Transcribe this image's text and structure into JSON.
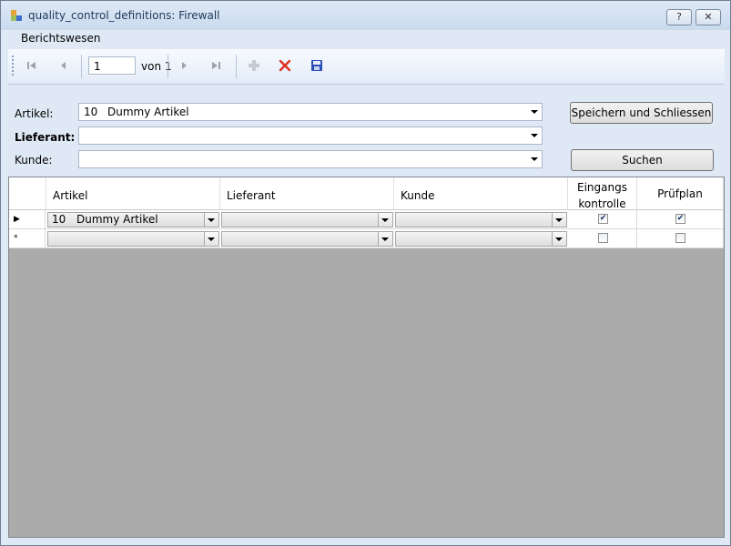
{
  "window": {
    "title": "quality_control_definitions: Firewall",
    "help_btn": "?",
    "close_btn": "✕"
  },
  "menu": {
    "items": [
      "Berichtswesen"
    ]
  },
  "navigator": {
    "position": "1",
    "count_text": "von 1",
    "colors": {
      "delete": "#e0301e",
      "save": "#2b4fb8"
    }
  },
  "form": {
    "artikel_label": "Artikel:",
    "artikel_num": "10",
    "artikel_name": "Dummy Artikel",
    "lieferant_label": "Lieferant:",
    "lieferant_value": "",
    "kunde_label": "Kunde:",
    "kunde_value": "",
    "save_close_button": "Speichern und Schliessen",
    "search_button": "Suchen"
  },
  "grid": {
    "columns": [
      "Artikel",
      "Lieferant",
      "Kunde",
      "Eingangs kontrolle",
      "Prüfplan"
    ],
    "columns_wrapped": {
      "eingangs_1": "Eingangs",
      "eingangs_2": "kontrolle"
    },
    "rows": [
      {
        "marker": "▶",
        "artikel_num": "10",
        "artikel_name": "Dummy Artikel",
        "lieferant": "",
        "kunde": "",
        "eingangskontrolle": true,
        "pruefplan": true
      },
      {
        "marker": "*",
        "artikel_num": "",
        "artikel_name": "",
        "lieferant": "",
        "kunde": "",
        "eingangskontrolle": false,
        "pruefplan": false
      }
    ]
  }
}
